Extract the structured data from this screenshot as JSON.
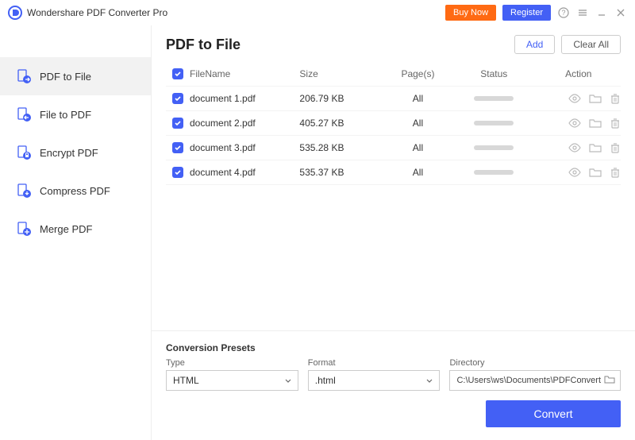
{
  "app": {
    "title": "Wondershare PDF Converter Pro"
  },
  "titlebar": {
    "buy": "Buy Now",
    "register": "Register"
  },
  "sidebar": {
    "items": [
      {
        "label": "PDF to File"
      },
      {
        "label": "File to PDF"
      },
      {
        "label": "Encrypt PDF"
      },
      {
        "label": "Compress PDF"
      },
      {
        "label": "Merge PDF"
      }
    ]
  },
  "page": {
    "title": "PDF to File",
    "add": "Add",
    "clear": "Clear All"
  },
  "table": {
    "headers": {
      "filename": "FileName",
      "size": "Size",
      "pages": "Page(s)",
      "status": "Status",
      "action": "Action"
    },
    "rows": [
      {
        "name": "document 1.pdf",
        "size": "206.79 KB",
        "pages": "All"
      },
      {
        "name": "document 2.pdf",
        "size": "405.27 KB",
        "pages": "All"
      },
      {
        "name": "document 3.pdf",
        "size": "535.28 KB",
        "pages": "All"
      },
      {
        "name": "document 4.pdf",
        "size": "535.37 KB",
        "pages": "All"
      }
    ]
  },
  "footer": {
    "presets": "Conversion Presets",
    "type_label": "Type",
    "type_value": "HTML",
    "format_label": "Format",
    "format_value": ".html",
    "dir_label": "Directory",
    "dir_value": "C:\\Users\\ws\\Documents\\PDFConvert",
    "convert": "Convert"
  }
}
